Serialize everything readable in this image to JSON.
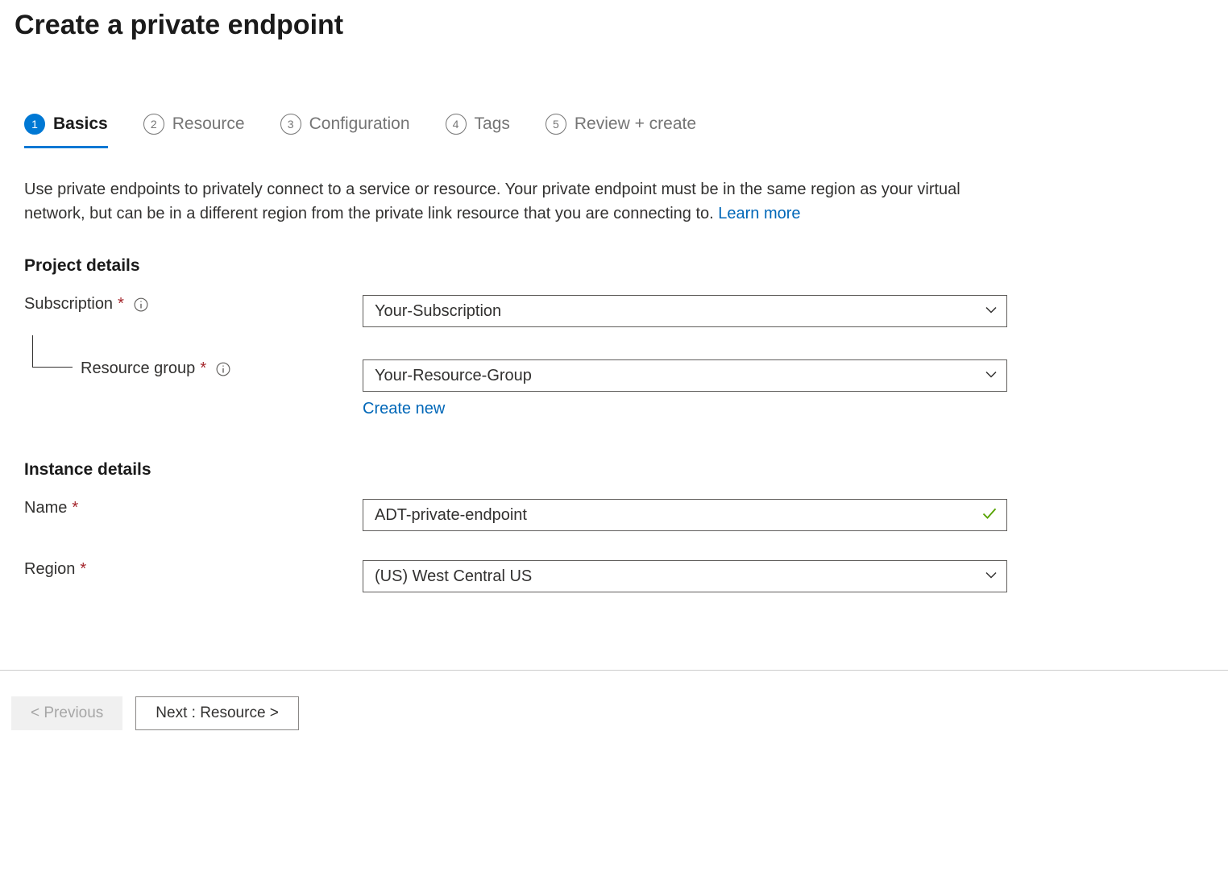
{
  "page_title": "Create a private endpoint",
  "tabs": [
    {
      "num": "1",
      "label": "Basics"
    },
    {
      "num": "2",
      "label": "Resource"
    },
    {
      "num": "3",
      "label": "Configuration"
    },
    {
      "num": "4",
      "label": "Tags"
    },
    {
      "num": "5",
      "label": "Review + create"
    }
  ],
  "description": {
    "text": "Use private endpoints to privately connect to a service or resource. Your private endpoint must be in the same region as your virtual network, but can be in a different region from the private link resource that you are connecting to.  ",
    "link_text": "Learn more"
  },
  "sections": {
    "project": {
      "heading": "Project details",
      "subscription_label": "Subscription",
      "subscription_value": "Your-Subscription",
      "resource_group_label": "Resource group",
      "resource_group_value": "Your-Resource-Group",
      "create_new_link": "Create new"
    },
    "instance": {
      "heading": "Instance details",
      "name_label": "Name",
      "name_value": "ADT-private-endpoint",
      "region_label": "Region",
      "region_value": "(US) West Central US"
    }
  },
  "footer": {
    "previous": "< Previous",
    "next": "Next : Resource >"
  }
}
